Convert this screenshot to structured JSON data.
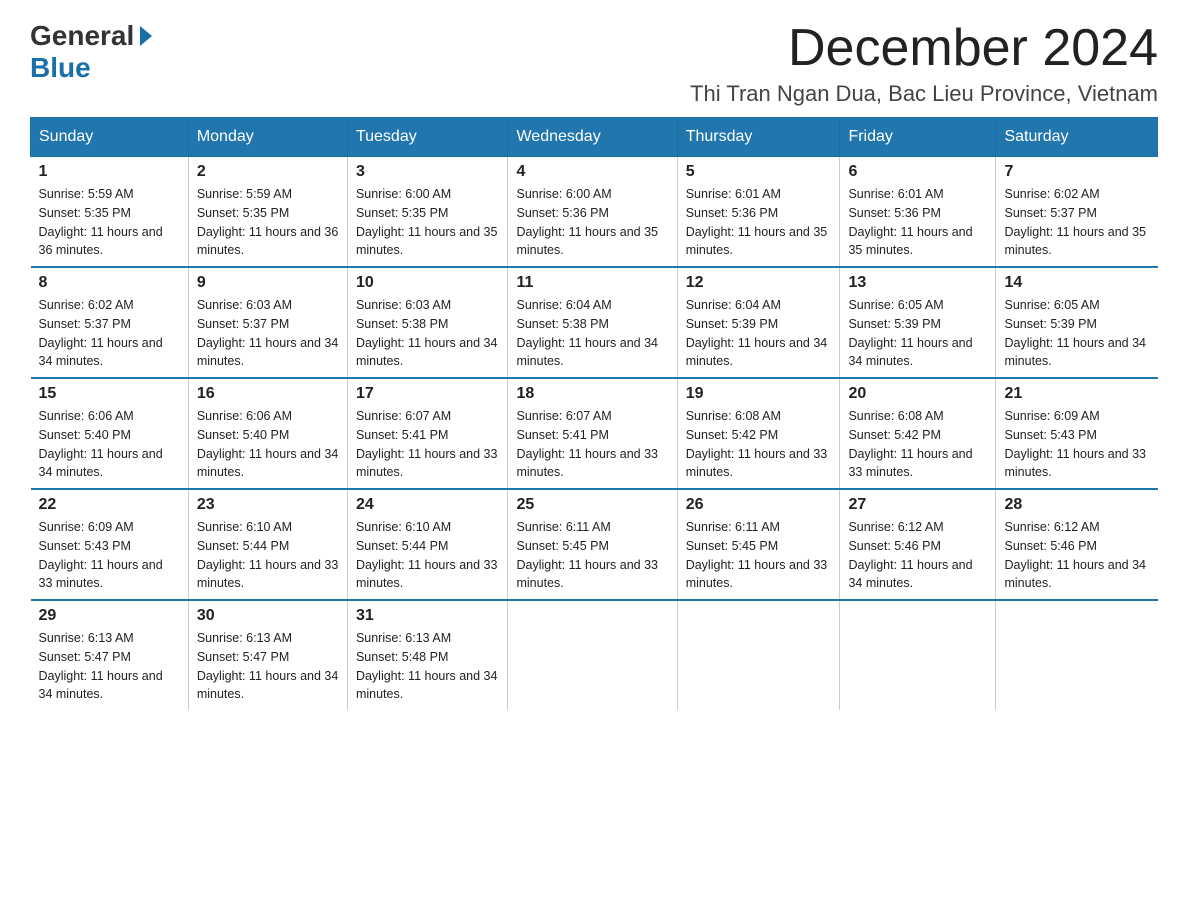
{
  "header": {
    "logo_general": "General",
    "logo_blue": "Blue",
    "month_title": "December 2024",
    "location": "Thi Tran Ngan Dua, Bac Lieu Province, Vietnam"
  },
  "days_of_week": [
    "Sunday",
    "Monday",
    "Tuesday",
    "Wednesday",
    "Thursday",
    "Friday",
    "Saturday"
  ],
  "weeks": [
    [
      {
        "day": "1",
        "sunrise": "Sunrise: 5:59 AM",
        "sunset": "Sunset: 5:35 PM",
        "daylight": "Daylight: 11 hours and 36 minutes."
      },
      {
        "day": "2",
        "sunrise": "Sunrise: 5:59 AM",
        "sunset": "Sunset: 5:35 PM",
        "daylight": "Daylight: 11 hours and 36 minutes."
      },
      {
        "day": "3",
        "sunrise": "Sunrise: 6:00 AM",
        "sunset": "Sunset: 5:35 PM",
        "daylight": "Daylight: 11 hours and 35 minutes."
      },
      {
        "day": "4",
        "sunrise": "Sunrise: 6:00 AM",
        "sunset": "Sunset: 5:36 PM",
        "daylight": "Daylight: 11 hours and 35 minutes."
      },
      {
        "day": "5",
        "sunrise": "Sunrise: 6:01 AM",
        "sunset": "Sunset: 5:36 PM",
        "daylight": "Daylight: 11 hours and 35 minutes."
      },
      {
        "day": "6",
        "sunrise": "Sunrise: 6:01 AM",
        "sunset": "Sunset: 5:36 PM",
        "daylight": "Daylight: 11 hours and 35 minutes."
      },
      {
        "day": "7",
        "sunrise": "Sunrise: 6:02 AM",
        "sunset": "Sunset: 5:37 PM",
        "daylight": "Daylight: 11 hours and 35 minutes."
      }
    ],
    [
      {
        "day": "8",
        "sunrise": "Sunrise: 6:02 AM",
        "sunset": "Sunset: 5:37 PM",
        "daylight": "Daylight: 11 hours and 34 minutes."
      },
      {
        "day": "9",
        "sunrise": "Sunrise: 6:03 AM",
        "sunset": "Sunset: 5:37 PM",
        "daylight": "Daylight: 11 hours and 34 minutes."
      },
      {
        "day": "10",
        "sunrise": "Sunrise: 6:03 AM",
        "sunset": "Sunset: 5:38 PM",
        "daylight": "Daylight: 11 hours and 34 minutes."
      },
      {
        "day": "11",
        "sunrise": "Sunrise: 6:04 AM",
        "sunset": "Sunset: 5:38 PM",
        "daylight": "Daylight: 11 hours and 34 minutes."
      },
      {
        "day": "12",
        "sunrise": "Sunrise: 6:04 AM",
        "sunset": "Sunset: 5:39 PM",
        "daylight": "Daylight: 11 hours and 34 minutes."
      },
      {
        "day": "13",
        "sunrise": "Sunrise: 6:05 AM",
        "sunset": "Sunset: 5:39 PM",
        "daylight": "Daylight: 11 hours and 34 minutes."
      },
      {
        "day": "14",
        "sunrise": "Sunrise: 6:05 AM",
        "sunset": "Sunset: 5:39 PM",
        "daylight": "Daylight: 11 hours and 34 minutes."
      }
    ],
    [
      {
        "day": "15",
        "sunrise": "Sunrise: 6:06 AM",
        "sunset": "Sunset: 5:40 PM",
        "daylight": "Daylight: 11 hours and 34 minutes."
      },
      {
        "day": "16",
        "sunrise": "Sunrise: 6:06 AM",
        "sunset": "Sunset: 5:40 PM",
        "daylight": "Daylight: 11 hours and 34 minutes."
      },
      {
        "day": "17",
        "sunrise": "Sunrise: 6:07 AM",
        "sunset": "Sunset: 5:41 PM",
        "daylight": "Daylight: 11 hours and 33 minutes."
      },
      {
        "day": "18",
        "sunrise": "Sunrise: 6:07 AM",
        "sunset": "Sunset: 5:41 PM",
        "daylight": "Daylight: 11 hours and 33 minutes."
      },
      {
        "day": "19",
        "sunrise": "Sunrise: 6:08 AM",
        "sunset": "Sunset: 5:42 PM",
        "daylight": "Daylight: 11 hours and 33 minutes."
      },
      {
        "day": "20",
        "sunrise": "Sunrise: 6:08 AM",
        "sunset": "Sunset: 5:42 PM",
        "daylight": "Daylight: 11 hours and 33 minutes."
      },
      {
        "day": "21",
        "sunrise": "Sunrise: 6:09 AM",
        "sunset": "Sunset: 5:43 PM",
        "daylight": "Daylight: 11 hours and 33 minutes."
      }
    ],
    [
      {
        "day": "22",
        "sunrise": "Sunrise: 6:09 AM",
        "sunset": "Sunset: 5:43 PM",
        "daylight": "Daylight: 11 hours and 33 minutes."
      },
      {
        "day": "23",
        "sunrise": "Sunrise: 6:10 AM",
        "sunset": "Sunset: 5:44 PM",
        "daylight": "Daylight: 11 hours and 33 minutes."
      },
      {
        "day": "24",
        "sunrise": "Sunrise: 6:10 AM",
        "sunset": "Sunset: 5:44 PM",
        "daylight": "Daylight: 11 hours and 33 minutes."
      },
      {
        "day": "25",
        "sunrise": "Sunrise: 6:11 AM",
        "sunset": "Sunset: 5:45 PM",
        "daylight": "Daylight: 11 hours and 33 minutes."
      },
      {
        "day": "26",
        "sunrise": "Sunrise: 6:11 AM",
        "sunset": "Sunset: 5:45 PM",
        "daylight": "Daylight: 11 hours and 33 minutes."
      },
      {
        "day": "27",
        "sunrise": "Sunrise: 6:12 AM",
        "sunset": "Sunset: 5:46 PM",
        "daylight": "Daylight: 11 hours and 34 minutes."
      },
      {
        "day": "28",
        "sunrise": "Sunrise: 6:12 AM",
        "sunset": "Sunset: 5:46 PM",
        "daylight": "Daylight: 11 hours and 34 minutes."
      }
    ],
    [
      {
        "day": "29",
        "sunrise": "Sunrise: 6:13 AM",
        "sunset": "Sunset: 5:47 PM",
        "daylight": "Daylight: 11 hours and 34 minutes."
      },
      {
        "day": "30",
        "sunrise": "Sunrise: 6:13 AM",
        "sunset": "Sunset: 5:47 PM",
        "daylight": "Daylight: 11 hours and 34 minutes."
      },
      {
        "day": "31",
        "sunrise": "Sunrise: 6:13 AM",
        "sunset": "Sunset: 5:48 PM",
        "daylight": "Daylight: 11 hours and 34 minutes."
      },
      null,
      null,
      null,
      null
    ]
  ]
}
